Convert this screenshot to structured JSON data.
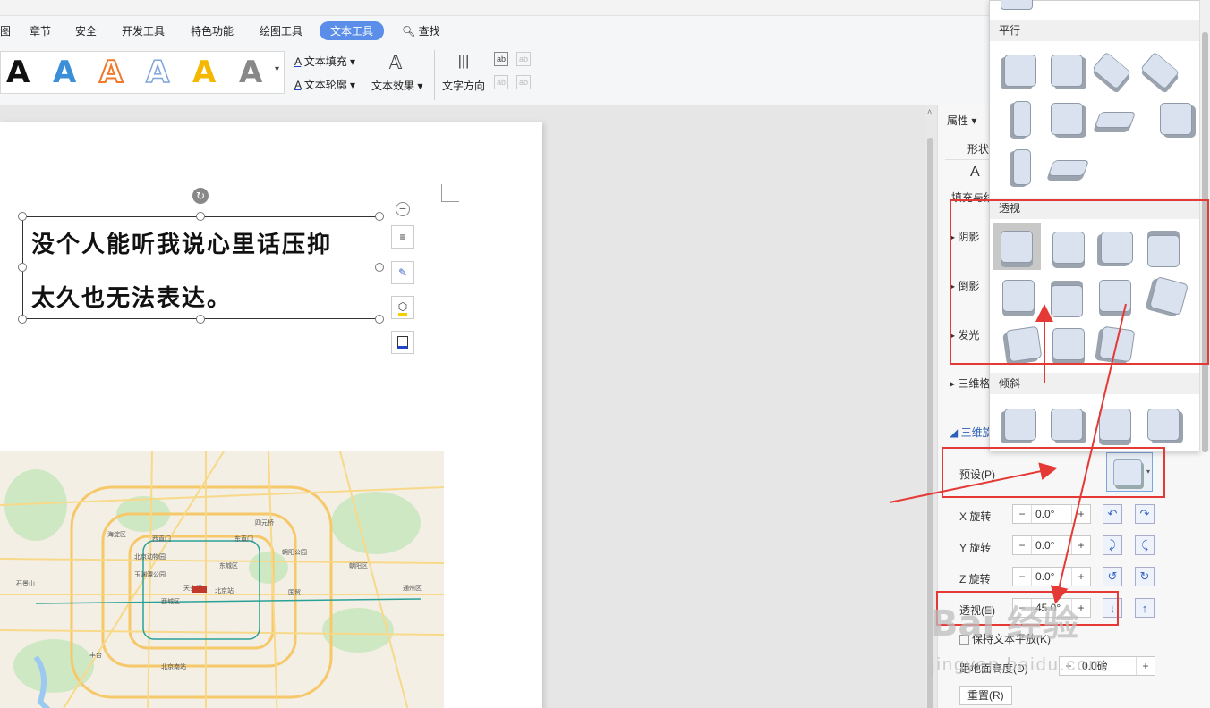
{
  "menu": {
    "items": [
      "图",
      "章节",
      "安全",
      "开发工具",
      "特色功能",
      "绘图工具",
      "文本工具"
    ],
    "search": "查找"
  },
  "toolbar": {
    "fill_label": "文本填充",
    "outline_label": "文本轮廓",
    "effect_label": "文本效果",
    "direction_label": "文字方向",
    "style_letter": "A",
    "style_colors": [
      "#111111",
      "#3b8fd8",
      "#f07a2a",
      "#7fa6d8",
      "#f5b800",
      "#888888"
    ]
  },
  "document": {
    "line1": "没个人能听我说心里话压抑",
    "line2": "太久也无法表达。"
  },
  "map_labels": [
    "北京动物园",
    "北京站",
    "天安门",
    "玉渊潭公园",
    "北京南站",
    "朝阳公园",
    "四元桥",
    "西直门",
    "东直门",
    "国贸",
    "丰台",
    "海淀区",
    "朝阳区",
    "东城区",
    "西城区",
    "石景山",
    "通州区"
  ],
  "panel": {
    "tab_title": "属性",
    "shape_tab": "形状",
    "fill_label": "填充与线",
    "shadow": "阴影",
    "reflection": "倒影",
    "glow": "发光",
    "3d_format": "三维格",
    "3d_rotation": "三维旋",
    "preset": "预设(P)",
    "x_rot": "X 旋转",
    "y_rot": "Y 旋转",
    "z_rot": "Z 旋转",
    "perspective": "透视(E)",
    "x_val": "0.0°",
    "y_val": "0.0°",
    "z_val": "0.0°",
    "persp_val": "45.0°",
    "keep_text": "保持文本平放(K)",
    "dist_label": "距地面高度(D)",
    "dist_val": "0.0磅",
    "reset": "重置(R)"
  },
  "gallery": {
    "section_parallel": "平行",
    "section_perspective": "透视",
    "section_oblique": "倾斜"
  },
  "watermark": {
    "main": "Bai 经验",
    "url": "jingyan.baidu.com"
  },
  "colors": {
    "accent": "#5a8ee8",
    "annotation_red": "#e53935"
  }
}
